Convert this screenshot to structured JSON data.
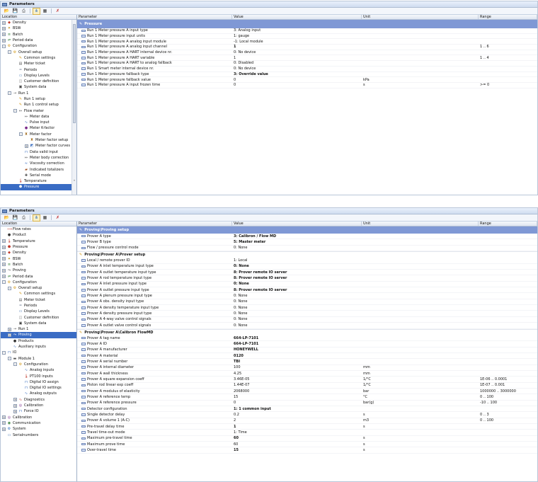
{
  "windows": [
    {
      "title": "Parameters",
      "toolbar_icons": [
        "folder-open-icon",
        "save-icon",
        "print-icon",
        "tree-icon",
        "grid-icon",
        "filter-icon"
      ],
      "tree_header": "Location",
      "columns": {
        "parameter": "Parameter",
        "value": "Value",
        "unit": "Unit",
        "range": "Range"
      },
      "tree": [
        {
          "depth": 0,
          "exp": "+",
          "icon": "density-icon",
          "label": "Density"
        },
        {
          "depth": 0,
          "exp": "+",
          "icon": "bsw-icon",
          "label": "BSW"
        },
        {
          "depth": 0,
          "exp": "+",
          "icon": "batch-icon",
          "label": "Batch"
        },
        {
          "depth": 0,
          "exp": "+",
          "icon": "period-icon",
          "label": "Period data"
        },
        {
          "depth": 0,
          "exp": "-",
          "icon": "configuration-icon",
          "label": "Configuration"
        },
        {
          "depth": 1,
          "exp": "-",
          "icon": "configuration-icon",
          "label": "Overall setup"
        },
        {
          "depth": 2,
          "exp": "",
          "icon": "common-settings-icon",
          "label": "Common settings"
        },
        {
          "depth": 2,
          "exp": "",
          "icon": "ticket-icon",
          "label": "Meter ticket"
        },
        {
          "depth": 2,
          "exp": "",
          "icon": "periods-icon",
          "label": "Periods"
        },
        {
          "depth": 2,
          "exp": "",
          "icon": "display-icon",
          "label": "Display Levels"
        },
        {
          "depth": 2,
          "exp": "",
          "icon": "customer-icon",
          "label": "Customer definition"
        },
        {
          "depth": 2,
          "exp": "",
          "icon": "system-data-icon",
          "label": "System data"
        },
        {
          "depth": 1,
          "exp": "-",
          "icon": "run-icon",
          "label": "Run 1"
        },
        {
          "depth": 2,
          "exp": "",
          "icon": "run-setup-icon",
          "label": "Run 1 setup"
        },
        {
          "depth": 2,
          "exp": "",
          "icon": "control-setup-icon",
          "label": "Run 1 control setup"
        },
        {
          "depth": 2,
          "exp": "-",
          "icon": "flow-meter-icon",
          "label": "Flow meter"
        },
        {
          "depth": 3,
          "exp": "",
          "icon": "meter-data-icon",
          "label": "Meter data"
        },
        {
          "depth": 3,
          "exp": "",
          "icon": "pulse-input-icon",
          "label": "Pulse input"
        },
        {
          "depth": 3,
          "exp": "",
          "icon": "k-factor-icon",
          "label": "Meter K-factor"
        },
        {
          "depth": 3,
          "exp": "-",
          "icon": "meter-factor-icon",
          "label": "Meter factor"
        },
        {
          "depth": 4,
          "exp": "",
          "icon": "meter-factor-setup-icon",
          "label": "Meter factor setup"
        },
        {
          "depth": 4,
          "exp": "+",
          "icon": "curve-icon",
          "label": "Meter factor curves"
        },
        {
          "depth": 3,
          "exp": "",
          "icon": "data-valid-icon",
          "label": "Data valid input"
        },
        {
          "depth": 3,
          "exp": "",
          "icon": "body-correction-icon",
          "label": "Meter body correction"
        },
        {
          "depth": 3,
          "exp": "",
          "icon": "viscosity-icon",
          "label": "Viscosity correction"
        },
        {
          "depth": 3,
          "exp": "",
          "icon": "totalizer-icon",
          "label": "Indicated totalizers"
        },
        {
          "depth": 3,
          "exp": "",
          "icon": "serial-mode-icon",
          "label": "Serial mode"
        },
        {
          "depth": 2,
          "exp": "",
          "icon": "temperature-icon",
          "label": "Temperature"
        },
        {
          "depth": 2,
          "exp": "",
          "icon": "pressure-icon",
          "label": "Pressure",
          "selected": true
        }
      ],
      "grid": [
        {
          "kind": "section",
          "label": "Pressure"
        },
        {
          "kind": "row",
          "p": "Run 1 Meter pressure A input type",
          "v": "3: Analog input",
          "u": "",
          "r": ""
        },
        {
          "kind": "row",
          "p": "Run 1 Meter pressure input units",
          "v": "1: gauge",
          "u": "",
          "r": ""
        },
        {
          "kind": "row",
          "p": "Run 1 Meter pressure A analog input module",
          "v": "-1: Local module",
          "u": "",
          "r": ""
        },
        {
          "kind": "row",
          "p": "Run 1 Meter pressure A analog input channel",
          "v": "1",
          "u": "",
          "r": "1 .. 6",
          "bold": true
        },
        {
          "kind": "row",
          "p": "Run 1 Meter pressure A HART internal device nr.",
          "v": "0: No device",
          "u": "",
          "r": ""
        },
        {
          "kind": "row",
          "p": "Run 1 Meter pressure A HART variable",
          "v": "1",
          "u": "",
          "r": "1 .. 4"
        },
        {
          "kind": "row",
          "p": "Run 1 Meter pressure A HART to analog fallback",
          "v": "0: Disabled",
          "u": "",
          "r": ""
        },
        {
          "kind": "row",
          "p": "Run 1 Smart meter internal device nr.",
          "v": "0: No device",
          "u": "",
          "r": ""
        },
        {
          "kind": "row",
          "p": "Run 1 Meter pressure fallback type",
          "v": "3: Override value",
          "u": "",
          "r": "",
          "bold": true
        },
        {
          "kind": "row",
          "p": "Run 1 Meter pressure fallback value",
          "v": "0",
          "u": "kPa",
          "r": ""
        },
        {
          "kind": "row",
          "p": "Run 1 Meter pressure A input frozen time",
          "v": "0",
          "u": "s",
          "r": ">= 0"
        }
      ]
    },
    {
      "title": "Parameters",
      "toolbar_icons": [
        "folder-open-icon",
        "save-icon",
        "print-icon",
        "tree-icon",
        "grid-icon",
        "filter-icon"
      ],
      "tree_header": "Location",
      "columns": {
        "parameter": "Parameter",
        "value": "Value",
        "unit": "Unit",
        "range": "Range"
      },
      "tree": [
        {
          "depth": 0,
          "exp": "",
          "icon": "flow-rates-icon",
          "label": "Flow rates"
        },
        {
          "depth": 0,
          "exp": "",
          "icon": "product-icon",
          "label": "Product"
        },
        {
          "depth": 0,
          "exp": "+",
          "icon": "temperature-icon",
          "label": "Temperature"
        },
        {
          "depth": 0,
          "exp": "+",
          "icon": "pressure-icon",
          "label": "Pressure"
        },
        {
          "depth": 0,
          "exp": "+",
          "icon": "density-icon",
          "label": "Density"
        },
        {
          "depth": 0,
          "exp": "+",
          "icon": "bsw-icon",
          "label": "BSW"
        },
        {
          "depth": 0,
          "exp": "+",
          "icon": "batch-icon",
          "label": "Batch"
        },
        {
          "depth": 0,
          "exp": "+",
          "icon": "proving-icon",
          "label": "Proving"
        },
        {
          "depth": 0,
          "exp": "+",
          "icon": "period-icon",
          "label": "Period data"
        },
        {
          "depth": 0,
          "exp": "-",
          "icon": "configuration-icon",
          "label": "Configuration"
        },
        {
          "depth": 1,
          "exp": "-",
          "icon": "configuration-icon",
          "label": "Overall setup"
        },
        {
          "depth": 2,
          "exp": "",
          "icon": "common-settings-icon",
          "label": "Common settings"
        },
        {
          "depth": 2,
          "exp": "",
          "icon": "ticket-icon",
          "label": "Meter ticket"
        },
        {
          "depth": 2,
          "exp": "",
          "icon": "periods-icon",
          "label": "Periods"
        },
        {
          "depth": 2,
          "exp": "",
          "icon": "display-icon",
          "label": "Display Levels"
        },
        {
          "depth": 2,
          "exp": "",
          "icon": "customer-icon",
          "label": "Customer definition"
        },
        {
          "depth": 2,
          "exp": "",
          "icon": "system-data-icon",
          "label": "System data"
        },
        {
          "depth": 1,
          "exp": "+",
          "icon": "run-icon",
          "label": "Run 1"
        },
        {
          "depth": 1,
          "exp": "+",
          "icon": "proving-icon",
          "label": "Proving",
          "selected": true
        },
        {
          "depth": 1,
          "exp": "",
          "icon": "products-icon",
          "label": "Products"
        },
        {
          "depth": 1,
          "exp": "",
          "icon": "auxiliary-icon",
          "label": "Auxiliary inputs"
        },
        {
          "depth": 0,
          "exp": "-",
          "icon": "io-icon",
          "label": "IO"
        },
        {
          "depth": 1,
          "exp": "-",
          "icon": "module-icon",
          "label": "Module 1"
        },
        {
          "depth": 2,
          "exp": "-",
          "icon": "configuration-icon",
          "label": "Configuration"
        },
        {
          "depth": 3,
          "exp": "",
          "icon": "analog-input-icon",
          "label": "Analog inputs"
        },
        {
          "depth": 3,
          "exp": "",
          "icon": "pt100-icon",
          "label": "PT100 inputs"
        },
        {
          "depth": 3,
          "exp": "",
          "icon": "digital-io-icon",
          "label": "Digital IO assign"
        },
        {
          "depth": 3,
          "exp": "",
          "icon": "digital-io-icon",
          "label": "Digital IO settings"
        },
        {
          "depth": 3,
          "exp": "",
          "icon": "analog-output-icon",
          "label": "Analog outputs"
        },
        {
          "depth": 2,
          "exp": "+",
          "icon": "diagnostics-icon",
          "label": "Diagnostics"
        },
        {
          "depth": 2,
          "exp": "+",
          "icon": "calibration-icon",
          "label": "Calibration"
        },
        {
          "depth": 2,
          "exp": "+",
          "icon": "force-io-icon",
          "label": "Force IO"
        },
        {
          "depth": 0,
          "exp": "+",
          "icon": "calibration-icon",
          "label": "Calibration"
        },
        {
          "depth": 0,
          "exp": "+",
          "icon": "communication-icon",
          "label": "Communication"
        },
        {
          "depth": 0,
          "exp": "+",
          "icon": "system-icon",
          "label": "System"
        },
        {
          "depth": 0,
          "exp": "",
          "icon": "serial-numbers-icon",
          "label": "Serialnumbers"
        }
      ],
      "grid": [
        {
          "kind": "section",
          "label": "Proving\\Proving setup"
        },
        {
          "kind": "row",
          "p": "Prover A type",
          "v": "3: Calibron / Flow MD",
          "u": "",
          "r": "",
          "bold": true
        },
        {
          "kind": "row",
          "p": "Prover B type",
          "v": "5: Master meter",
          "u": "",
          "r": "",
          "bold": true
        },
        {
          "kind": "row",
          "p": "Flow / pressure control mode",
          "v": "0: None",
          "u": "",
          "r": ""
        },
        {
          "kind": "sub",
          "label": "Proving\\Prover A\\Prover setup"
        },
        {
          "kind": "row",
          "p": "Local / remote prover ID",
          "v": "1: Local",
          "u": "",
          "r": ""
        },
        {
          "kind": "row",
          "p": "Prover A inlet temperature input type",
          "v": "0: None",
          "u": "",
          "r": "",
          "bold": true
        },
        {
          "kind": "row",
          "p": "Prover A outlet temperature input type",
          "v": "8: Prover remote IO server",
          "u": "",
          "r": "",
          "bold": true
        },
        {
          "kind": "row",
          "p": "Prover A rod temperature input type",
          "v": "8: Prover remote IO server",
          "u": "",
          "r": "",
          "bold": true
        },
        {
          "kind": "row",
          "p": "Prover A inlet pressure input type",
          "v": "0: None",
          "u": "",
          "r": "",
          "bold": true
        },
        {
          "kind": "row",
          "p": "Prover A outlet pressure input type",
          "v": "8: Prover remote IO server",
          "u": "",
          "r": "",
          "bold": true
        },
        {
          "kind": "row",
          "p": "Prover A plenum pressure input type",
          "v": "0: None",
          "u": "",
          "r": ""
        },
        {
          "kind": "row",
          "p": "Prover A obs. density input type",
          "v": "0: None",
          "u": "",
          "r": ""
        },
        {
          "kind": "row",
          "p": "Prover A density temperature input type",
          "v": "0: None",
          "u": "",
          "r": ""
        },
        {
          "kind": "row",
          "p": "Prover A density pressure input type",
          "v": "0: None",
          "u": "",
          "r": ""
        },
        {
          "kind": "row",
          "p": "Prover A 4-way valve control signals",
          "v": "0: None",
          "u": "",
          "r": ""
        },
        {
          "kind": "row",
          "p": "Prover A outlet valve control signals",
          "v": "0: None",
          "u": "",
          "r": ""
        },
        {
          "kind": "sub",
          "label": "Proving\\Prover A\\Calibron FlowMD"
        },
        {
          "kind": "row",
          "p": "Prover A tag name",
          "v": "664-LP-7101",
          "u": "",
          "r": "",
          "bold": true
        },
        {
          "kind": "row",
          "p": "Prover A ID",
          "v": "664-LP-7101",
          "u": "",
          "r": "",
          "bold": true
        },
        {
          "kind": "row",
          "p": "Prover A manufacturer",
          "v": "HONEYWELL",
          "u": "",
          "r": "",
          "bold": true
        },
        {
          "kind": "row",
          "p": "Prover A material",
          "v": "0120",
          "u": "",
          "r": "",
          "bold": true
        },
        {
          "kind": "row",
          "p": "Prover A serial number",
          "v": "TBI",
          "u": "",
          "r": "",
          "bold": true
        },
        {
          "kind": "row",
          "p": "Prover A internal diameter",
          "v": "100",
          "u": "mm",
          "r": ""
        },
        {
          "kind": "row",
          "p": "Prover A wall thickness",
          "v": "4.25",
          "u": "mm",
          "r": ""
        },
        {
          "kind": "row",
          "p": "Prover A square expansion coeff",
          "v": "3.46E-05",
          "u": "1/°C",
          "r": "1E-06 .. 0.0001"
        },
        {
          "kind": "row",
          "p": "Piston rod linear exp coeff",
          "v": "1.44E-07",
          "u": "1/°C",
          "r": "1E-07 .. 0.001"
        },
        {
          "kind": "row",
          "p": "Prover A modulus of elasticity",
          "v": "2068000",
          "u": "bar",
          "r": "1000000 .. 3000000"
        },
        {
          "kind": "row",
          "p": "Prover A reference temp",
          "v": "15",
          "u": "°C",
          "r": "0 .. 100"
        },
        {
          "kind": "row",
          "p": "Prover A reference pressure",
          "v": "0",
          "u": "bar(g)",
          "r": "-10 .. 100"
        },
        {
          "kind": "row",
          "p": "Detector configuration",
          "v": "1: 1 common input",
          "u": "",
          "r": "",
          "bold": true
        },
        {
          "kind": "row",
          "p": "Single detector delay",
          "v": "0.2",
          "u": "s",
          "r": "0 .. 3"
        },
        {
          "kind": "row",
          "p": "Prover A volume 1 (A-C)",
          "v": "2",
          "u": "m3",
          "r": "0 .. 100"
        },
        {
          "kind": "row",
          "p": "Pre-travel delay time",
          "v": "1",
          "u": "s",
          "r": "",
          "bold": true
        },
        {
          "kind": "row",
          "p": "Travel time-out mode",
          "v": "1: Time",
          "u": "",
          "r": ""
        },
        {
          "kind": "row",
          "p": "Maximum pre-travel time",
          "v": "60",
          "u": "s",
          "r": "",
          "bold": true
        },
        {
          "kind": "row",
          "p": "Maximum prove time",
          "v": "60",
          "u": "s",
          "r": ""
        },
        {
          "kind": "row",
          "p": "Over-travel time",
          "v": "15",
          "u": "s",
          "r": "",
          "bold": true
        }
      ]
    }
  ]
}
